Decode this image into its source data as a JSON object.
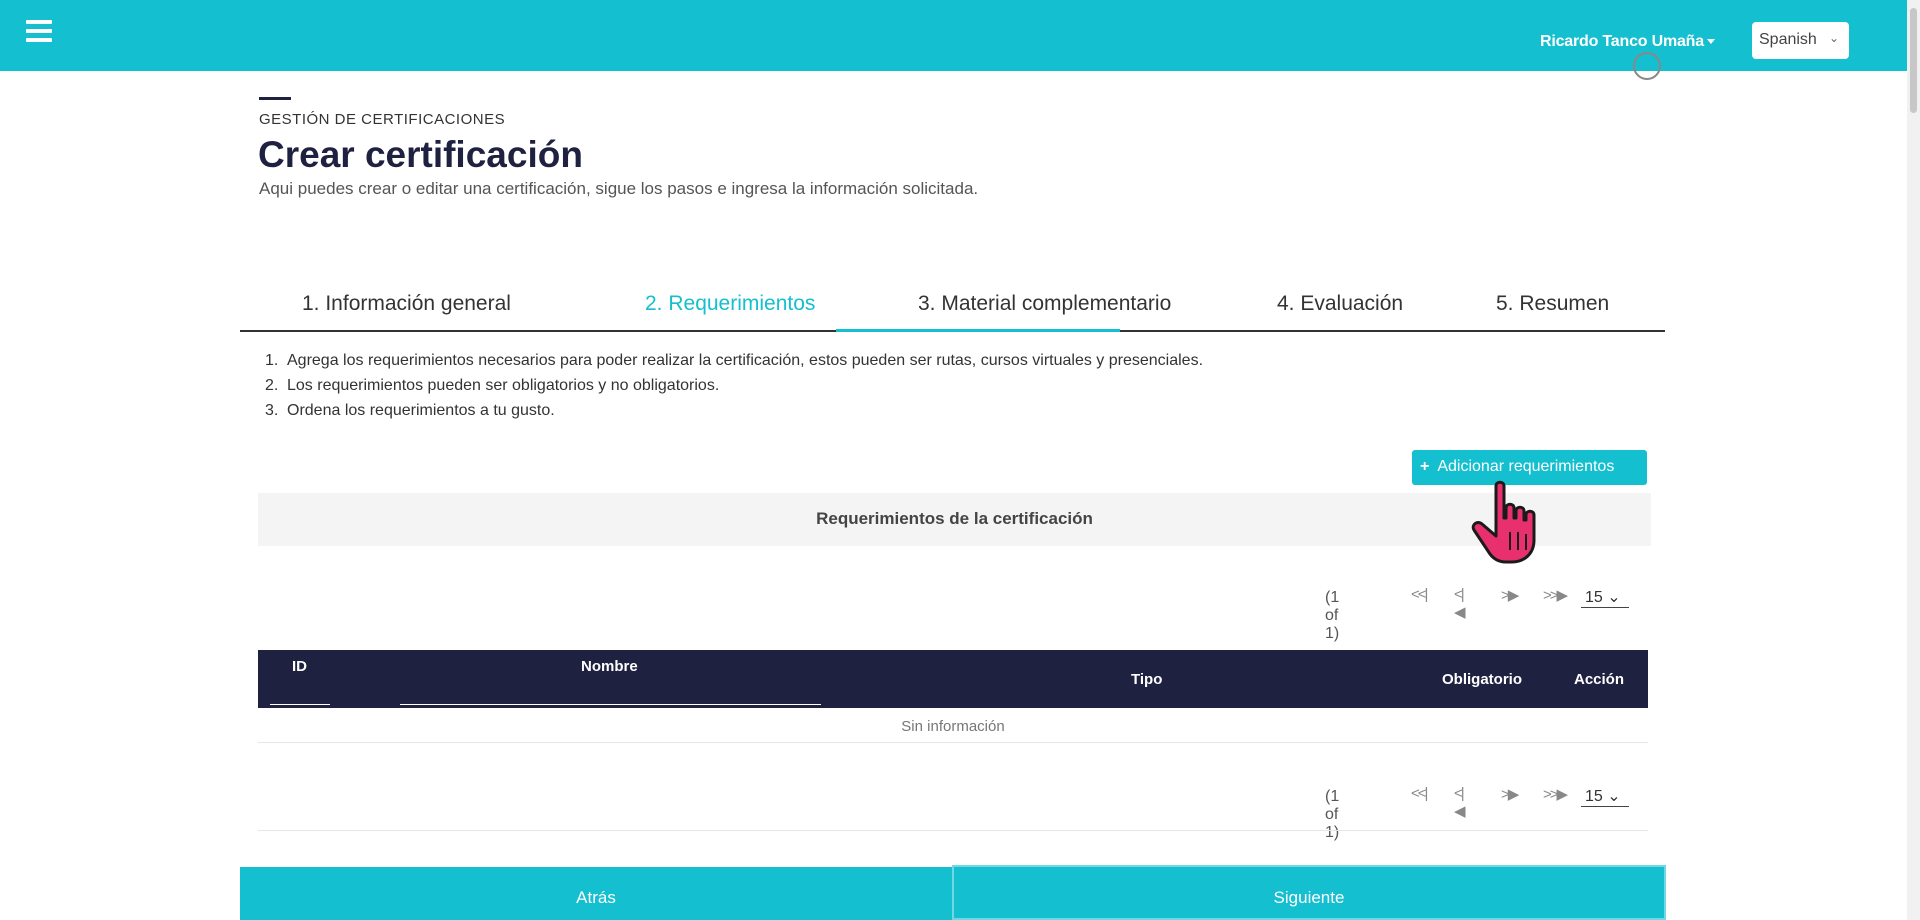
{
  "topbar": {
    "user_name": "Ricardo Tanco Umaña",
    "language": "Spanish",
    "accent_color": "#14bfcf",
    "dark_color": "#1f2140"
  },
  "header": {
    "breadcrumb": "GESTIÓN DE CERTIFICACIONES",
    "title": "Crear certificación",
    "subtitle": "Aqui puedes crear o editar una certificación, sigue los pasos e ingresa la información solicitada."
  },
  "tabs": [
    {
      "label": "1. Información general",
      "active": false
    },
    {
      "label": "2. Requerimientos",
      "active": true
    },
    {
      "label": "3. Material complementario",
      "active": false
    },
    {
      "label": "4. Evaluación",
      "active": false
    },
    {
      "label": "5. Resumen",
      "active": false
    }
  ],
  "instructions": [
    {
      "num": "1.",
      "text": "Agrega los requerimientos necesarios para poder realizar la certificación, estos pueden ser rutas, cursos virtuales y presenciales."
    },
    {
      "num": "2.",
      "text": "Los requerimientos pueden ser obligatorios y no obligatorios."
    },
    {
      "num": "3.",
      "text": "Ordena los requerimientos a tu gusto."
    }
  ],
  "add_button": {
    "icon": "+",
    "label": "Adicionar requerimientos"
  },
  "section": {
    "title": "Requerimientos de la certificación"
  },
  "paginator": {
    "report": "(1 of 1)",
    "first": "<<|",
    "prev": "<|◀",
    "next": ">▶",
    "last": ">>▶",
    "rows_per_page": "15"
  },
  "table": {
    "columns": [
      "ID",
      "Nombre",
      "Tipo",
      "Obligatorio",
      "Acción"
    ],
    "empty_message": "Sin información",
    "rows": []
  },
  "footer": {
    "back_label": "Atrás",
    "next_label": "Siguiente"
  },
  "icons": {
    "menu": "hamburger-icon",
    "cursor": "hand-pointer-icon"
  }
}
